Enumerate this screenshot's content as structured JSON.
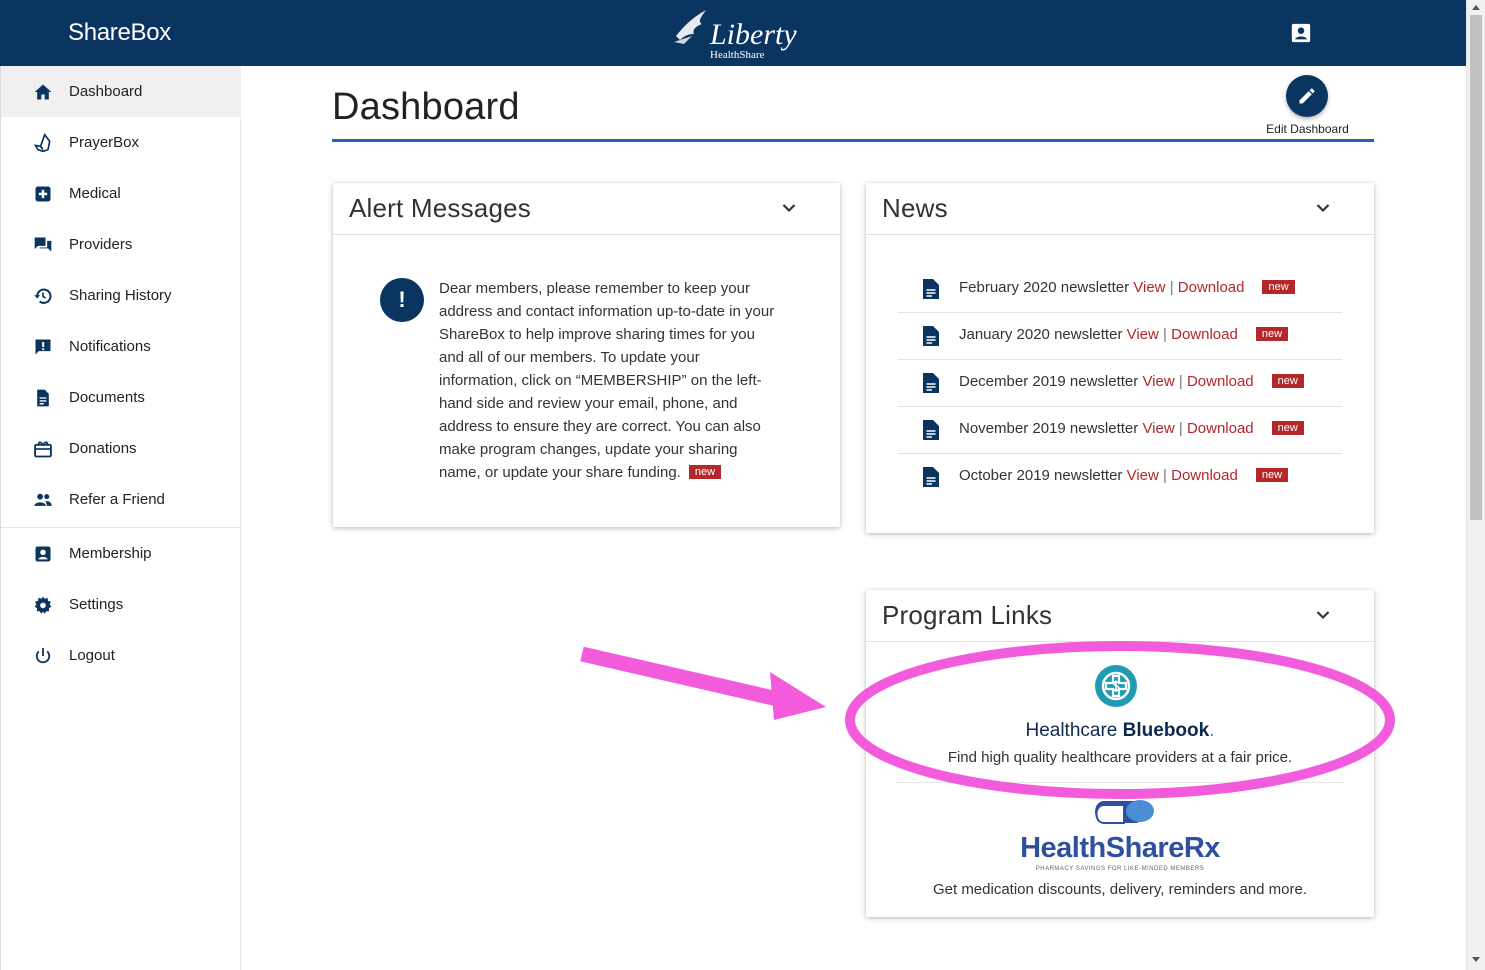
{
  "app": {
    "brand": "ShareBox",
    "logo_text": "Liberty",
    "logo_subtext": "HealthShare"
  },
  "sidebar": {
    "items": [
      {
        "label": "Dashboard",
        "icon": "home-icon",
        "active": true
      },
      {
        "label": "PrayerBox",
        "icon": "prayer-hands-icon"
      },
      {
        "label": "Medical",
        "icon": "medical-plus-icon"
      },
      {
        "label": "Providers",
        "icon": "chat-bubbles-icon"
      },
      {
        "label": "Sharing History",
        "icon": "history-icon"
      },
      {
        "label": "Notifications",
        "icon": "feedback-icon"
      },
      {
        "label": "Documents",
        "icon": "document-icon"
      },
      {
        "label": "Donations",
        "icon": "gift-card-icon"
      },
      {
        "label": "Refer a Friend",
        "icon": "people-icon"
      },
      {
        "label": "Membership",
        "icon": "account-box-icon"
      },
      {
        "label": "Settings",
        "icon": "gear-icon"
      },
      {
        "label": "Logout",
        "icon": "power-icon"
      }
    ]
  },
  "main": {
    "title": "Dashboard",
    "edit_label": "Edit Dashboard"
  },
  "alerts": {
    "title": "Alert Messages",
    "message": "Dear members, please remember to keep your address and contact information up-to-date in your ShareBox to help improve sharing times for you and all of our members. To update your information, click on “MEMBERSHIP” on the left-hand side and review your email, phone, and address to ensure they are correct. You can also make program changes, update your sharing name, or update your share funding.",
    "badge": "new"
  },
  "news": {
    "title": "News",
    "view_label": "View",
    "separator": "|",
    "download_label": "Download",
    "badge": "new",
    "items": [
      {
        "title": "February 2020 newsletter"
      },
      {
        "title": "January 2020 newsletter"
      },
      {
        "title": "December 2019 newsletter"
      },
      {
        "title": "November 2019 newsletter"
      },
      {
        "title": "October 2019 newsletter"
      }
    ]
  },
  "program_links": {
    "title": "Program Links",
    "bluebook": {
      "name_regular": "Healthcare ",
      "name_bold": "Bluebook",
      "name_dot": ".",
      "description": "Find high quality healthcare providers at a fair price."
    },
    "rx": {
      "name": "HealthShareRx",
      "tagline": "PHARMACY SAVINGS FOR LIKE-MINDED MEMBERS",
      "description": "Get medication discounts, delivery, reminders and more."
    }
  },
  "colors": {
    "header": "#0b3561",
    "accent_rule": "#1f62b8",
    "link": "#b3272a",
    "badge": "#b5282a",
    "annotation": "#f25cdc"
  }
}
